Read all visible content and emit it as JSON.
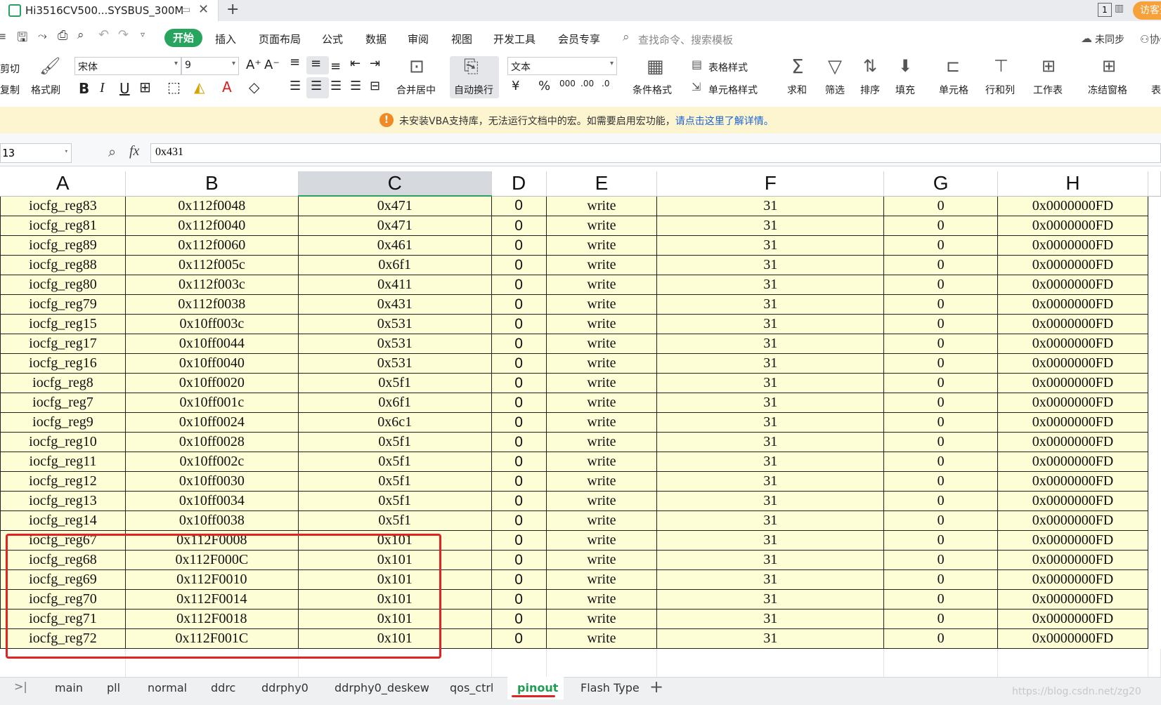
{
  "window": {
    "doc_title": "Hi3516CV500...SYSBUS_300M",
    "new_tab": "+",
    "visitor": "访客登录",
    "window_count": "1"
  },
  "menu": {
    "start": "开始",
    "items": [
      "插入",
      "页面布局",
      "公式",
      "数据",
      "审阅",
      "视图",
      "开发工具",
      "会员专享"
    ],
    "search_placeholder": "查找命令、搜索模板",
    "sync": "未同步",
    "collab": "协作"
  },
  "ribbon": {
    "cut": "剪切",
    "copy": "复制",
    "format_painter": "格式刷",
    "font_name": "宋体",
    "font_size": "9",
    "merge_center": "合并居中",
    "wrap_text": "自动换行",
    "number_format": "文本",
    "conditional_format": "条件格式",
    "table_style": "表格样式",
    "cell_style": "单元格样式",
    "sum": "求和",
    "filter": "筛选",
    "sort": "排序",
    "fill": "填充",
    "cells": "单元格",
    "row_col": "行和列",
    "worksheet": "工作表",
    "freeze": "冻结窗格",
    "more": "表"
  },
  "notice": {
    "text": "未安装VBA支持库，无法运行文档中的宏。如需要启用宏功能，",
    "link": "请点击这里了解详情。"
  },
  "formula_bar": {
    "name_box": "13",
    "fx": "fx",
    "value": "0x431"
  },
  "columns": [
    "A",
    "B",
    "C",
    "D",
    "E",
    "F",
    "G",
    "H"
  ],
  "selected_column": "C",
  "rows": [
    [
      "iocfg_reg83",
      "0x112f0048",
      "0x471",
      "0",
      "write",
      "31",
      "0",
      "0x0000000FD"
    ],
    [
      "iocfg_reg81",
      "0x112f0040",
      "0x471",
      "0",
      "write",
      "31",
      "0",
      "0x0000000FD"
    ],
    [
      "iocfg_reg89",
      "0x112f0060",
      "0x461",
      "0",
      "write",
      "31",
      "0",
      "0x0000000FD"
    ],
    [
      "iocfg_reg88",
      "0x112f005c",
      "0x6f1",
      "0",
      "write",
      "31",
      "0",
      "0x0000000FD"
    ],
    [
      "iocfg_reg80",
      "0x112f003c",
      "0x411",
      "0",
      "write",
      "31",
      "0",
      "0x0000000FD"
    ],
    [
      "iocfg_reg79",
      "0x112f0038",
      "0x431",
      "0",
      "write",
      "31",
      "0",
      "0x0000000FD"
    ],
    [
      "iocfg_reg15",
      "0x10ff003c",
      "0x531",
      "0",
      "write",
      "31",
      "0",
      "0x0000000FD"
    ],
    [
      "iocfg_reg17",
      "0x10ff0044",
      "0x531",
      "0",
      "write",
      "31",
      "0",
      "0x0000000FD"
    ],
    [
      "iocfg_reg16",
      "0x10ff0040",
      "0x531",
      "0",
      "write",
      "31",
      "0",
      "0x0000000FD"
    ],
    [
      "iocfg_reg8",
      "0x10ff0020",
      "0x5f1",
      "0",
      "write",
      "31",
      "0",
      "0x0000000FD"
    ],
    [
      "iocfg_reg7",
      "0x10ff001c",
      "0x6f1",
      "0",
      "write",
      "31",
      "0",
      "0x0000000FD"
    ],
    [
      "iocfg_reg9",
      "0x10ff0024",
      "0x6c1",
      "0",
      "write",
      "31",
      "0",
      "0x0000000FD"
    ],
    [
      "iocfg_reg10",
      "0x10ff0028",
      "0x5f1",
      "0",
      "write",
      "31",
      "0",
      "0x0000000FD"
    ],
    [
      "iocfg_reg11",
      "0x10ff002c",
      "0x5f1",
      "0",
      "write",
      "31",
      "0",
      "0x0000000FD"
    ],
    [
      "iocfg_reg12",
      "0x10ff0030",
      "0x5f1",
      "0",
      "write",
      "31",
      "0",
      "0x0000000FD"
    ],
    [
      "iocfg_reg13",
      "0x10ff0034",
      "0x5f1",
      "0",
      "write",
      "31",
      "0",
      "0x0000000FD"
    ],
    [
      "iocfg_reg14",
      "0x10ff0038",
      "0x5f1",
      "0",
      "write",
      "31",
      "0",
      "0x0000000FD"
    ],
    [
      "iocfg_reg67",
      "0x112F0008",
      "0x101",
      "0",
      "write",
      "31",
      "0",
      "0x0000000FD"
    ],
    [
      "iocfg_reg68",
      "0x112F000C",
      "0x101",
      "0",
      "write",
      "31",
      "0",
      "0x0000000FD"
    ],
    [
      "iocfg_reg69",
      "0x112F0010",
      "0x101",
      "0",
      "write",
      "31",
      "0",
      "0x0000000FD"
    ],
    [
      "iocfg_reg70",
      "0x112F0014",
      "0x101",
      "0",
      "write",
      "31",
      "0",
      "0x0000000FD"
    ],
    [
      "iocfg_reg71",
      "0x112F0018",
      "0x101",
      "0",
      "write",
      "31",
      "0",
      "0x0000000FD"
    ],
    [
      "iocfg_reg72",
      "0x112F001C",
      "0x101",
      "0",
      "write",
      "31",
      "0",
      "0x0000000FD"
    ]
  ],
  "sheet_tabs": [
    "main",
    "pll",
    "normal",
    "ddrc",
    "ddrphy0",
    "ddrphy0_deskew",
    "qos_ctrl",
    "pinout",
    "Flash Type"
  ],
  "active_sheet": "pinout",
  "add_sheet": "+",
  "watermark": "https://blog.csdn.net/zg20",
  "colors": {
    "accent": "#27a55e",
    "cell_fill": "#fdfdd6",
    "highlight": "#e02424",
    "notice_bg": "#fdf4d0"
  }
}
